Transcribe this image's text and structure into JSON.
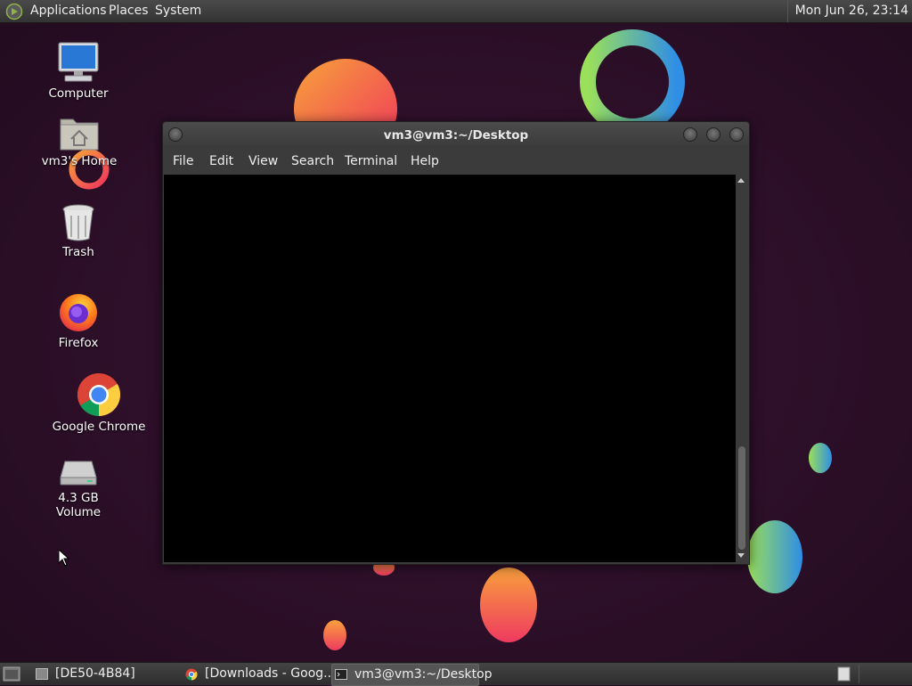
{
  "top_panel": {
    "menus": [
      "Applications",
      "Places",
      "System"
    ],
    "clock": "Mon Jun 26, 23:14"
  },
  "desktop": {
    "icons": [
      {
        "label": "Computer",
        "icon": "computer-icon"
      },
      {
        "label": "vm3's Home",
        "icon": "home-folder-icon"
      },
      {
        "label": "Trash",
        "icon": "trash-icon"
      },
      {
        "label": "Firefox",
        "icon": "firefox-icon"
      },
      {
        "label": "Google Chrome",
        "icon": "chrome-icon"
      },
      {
        "label": "4.3 GB Volume",
        "icon": "drive-icon"
      }
    ]
  },
  "terminal": {
    "title": "vm3@vm3:~/Desktop",
    "menu": [
      "File",
      "Edit",
      "View",
      "Search",
      "Terminal",
      "Help"
    ]
  },
  "taskbar": {
    "items": [
      {
        "label": "[DE50-4B84]",
        "icon": "window-icon"
      },
      {
        "label": "[Downloads - Goog...",
        "icon": "chrome-icon"
      },
      {
        "label": "vm3@vm3:~/Desktop",
        "icon": "terminal-icon",
        "active": true
      }
    ]
  },
  "colors": {
    "background": "#2a0f26",
    "panel": "#3a3a3a",
    "terminal_bg": "#000000"
  }
}
